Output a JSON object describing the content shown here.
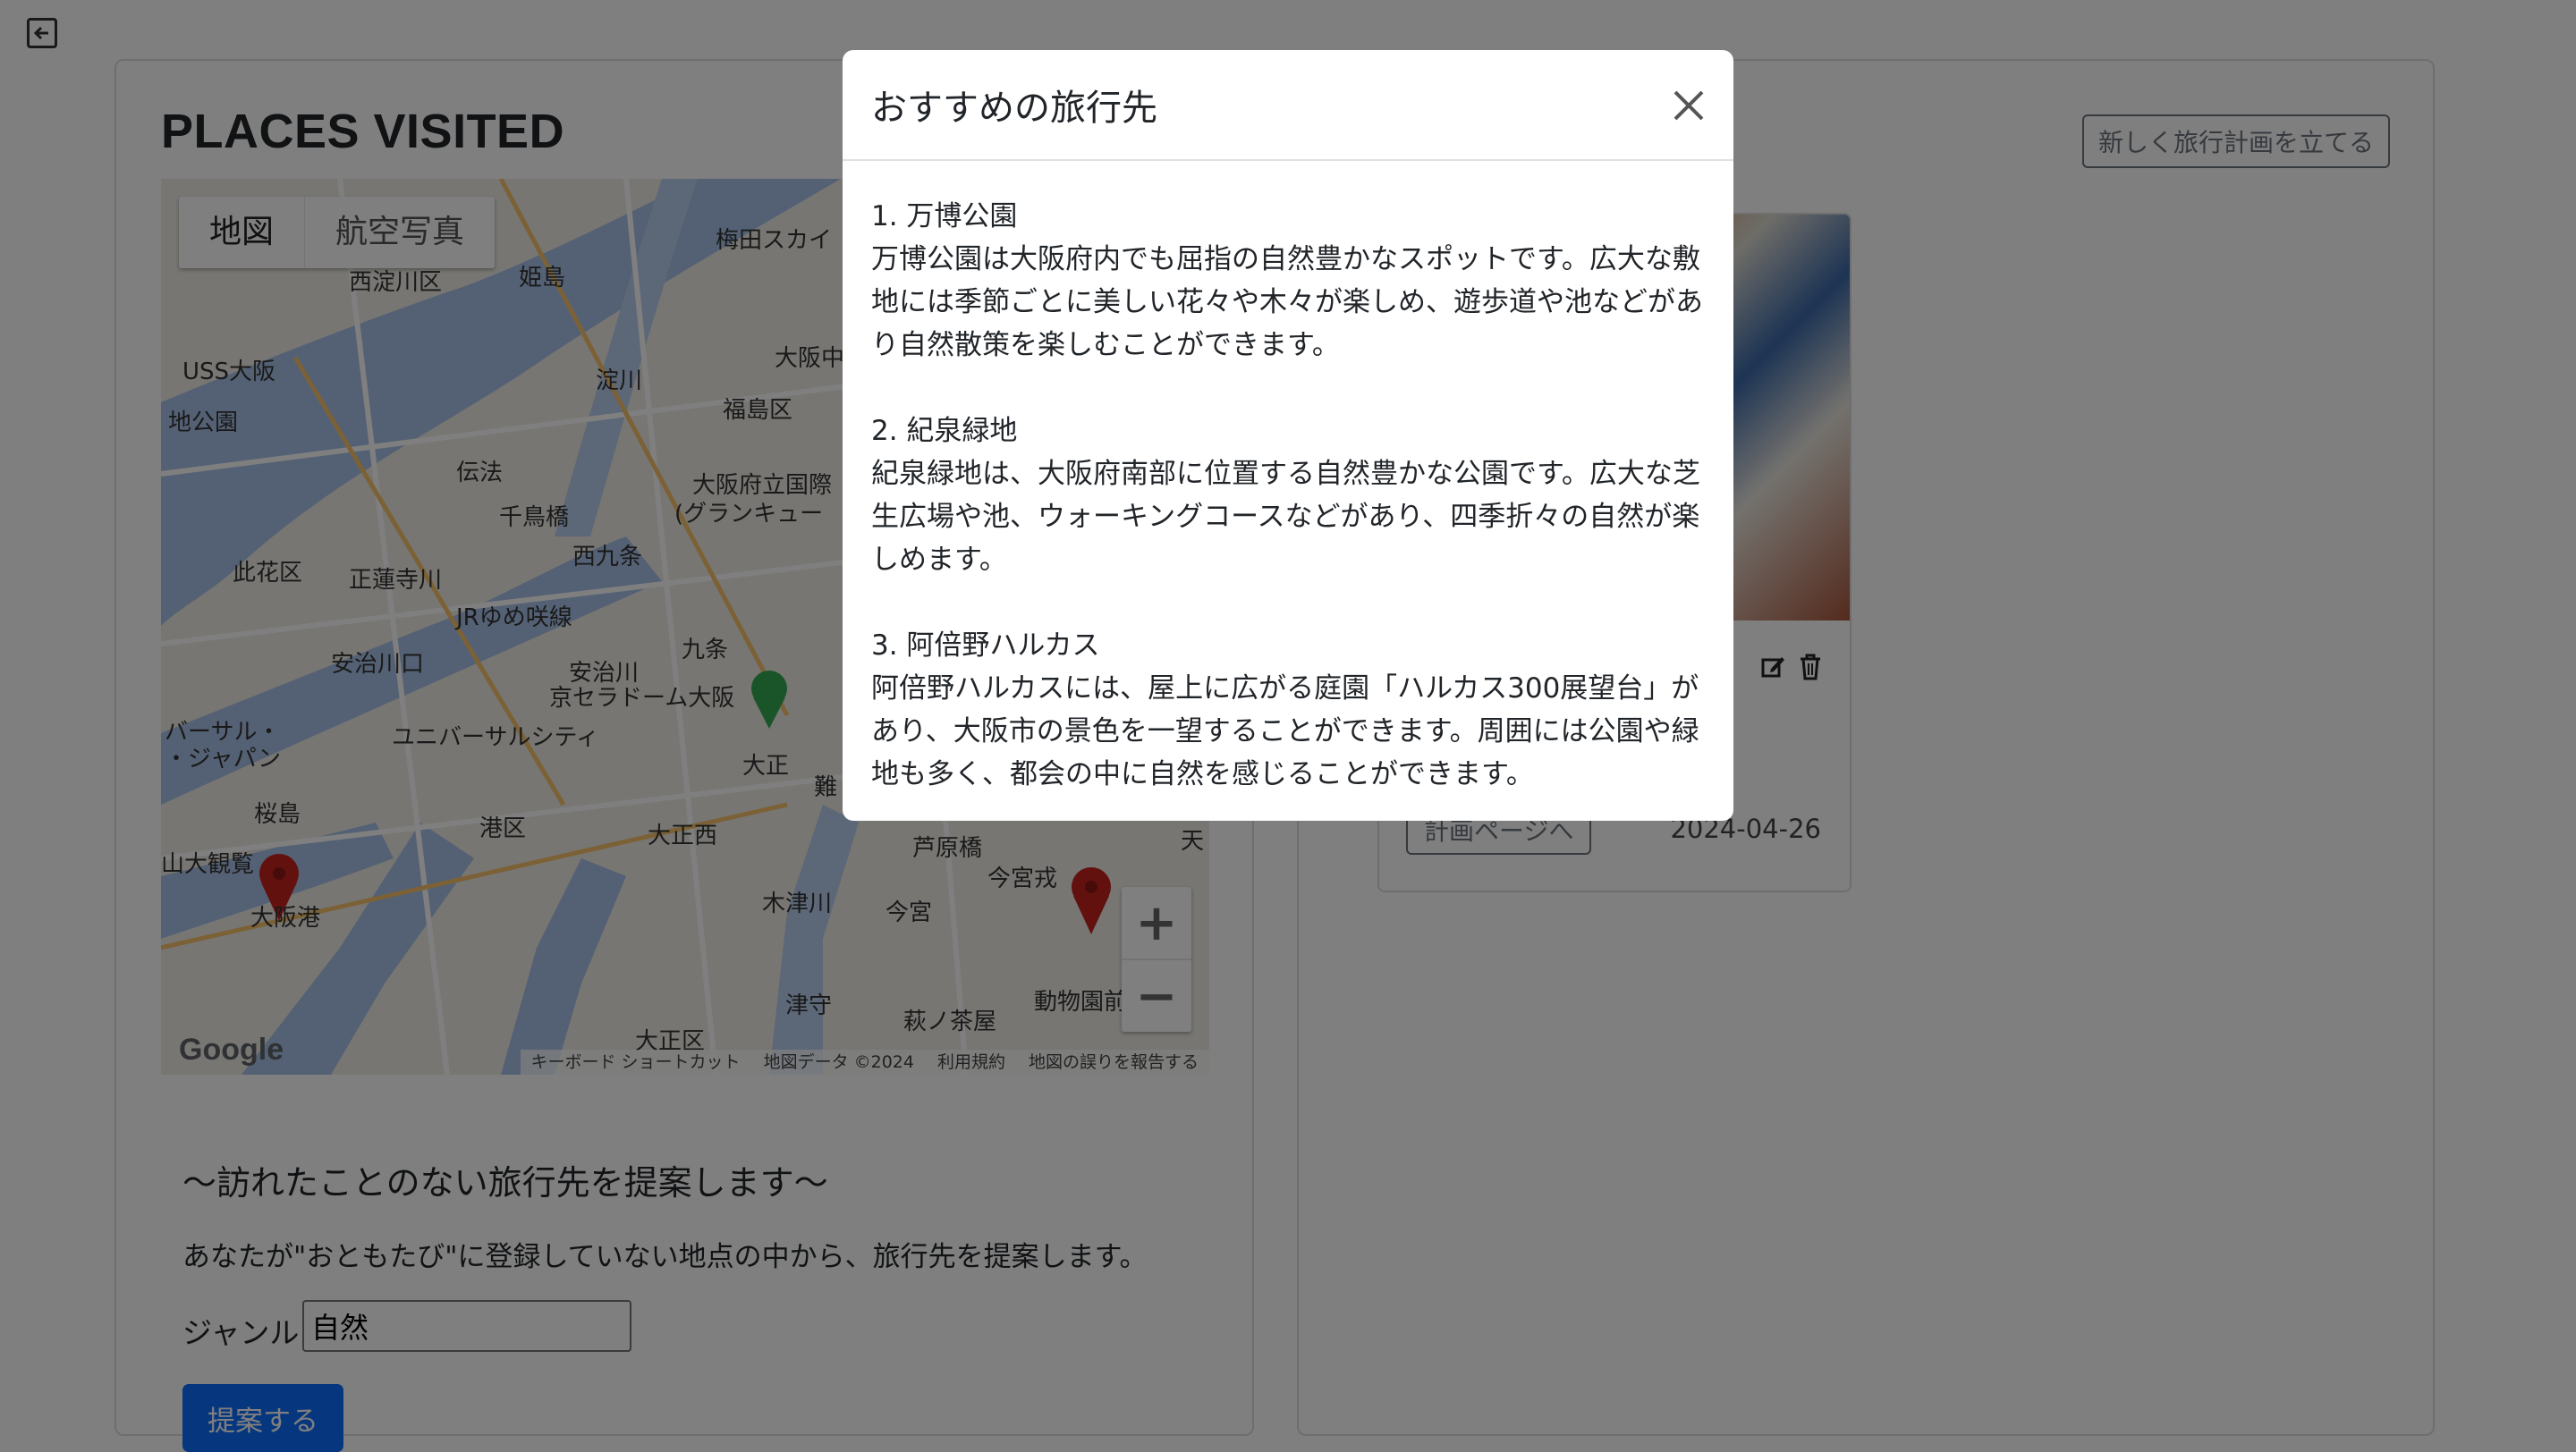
{
  "page": {
    "title": "PLACES VISITED",
    "new_plan_label": "新しく旅行計画を立てる"
  },
  "map": {
    "type_buttons": [
      "地図",
      "航空写真"
    ],
    "zoom_in": "+",
    "zoom_out": "−",
    "google_logo": "Google",
    "attribution": [
      "キーボード ショートカット",
      "地図データ ©2024",
      "利用規約",
      "地図の誤りを報告する"
    ],
    "labels": [
      "西淀川区",
      "姫島",
      "梅田スカイ",
      "USS大阪",
      "地公園",
      "淀川",
      "大阪中",
      "福島区",
      "伝法",
      "千鳥橋",
      "大阪府立国際",
      "(グランキュー",
      "西九条",
      "此花区",
      "正蓮寺川",
      "JRゆめ咲線",
      "安治川口",
      "九条",
      "京セラドーム大阪",
      "安治川",
      "ユニバーサルシティ",
      "バーサル・",
      "・ジャパン",
      "大正",
      "桜島",
      "港区",
      "大正西",
      "難",
      "芦原橋",
      "大阪港",
      "山大観覧",
      "木津川",
      "今宮",
      "今宮戎",
      "大正区",
      "津守",
      "萩ノ茶屋",
      "動物園前",
      "天"
    ]
  },
  "suggest": {
    "heading": "〜訪れたことのない旅行先を提案します〜",
    "description": "あなたが\"おともたび\"に登録していない地点の中から、旅行先を提案します。",
    "genre_label": "ジャンル",
    "genre_value": "自然",
    "button_label": "提案する"
  },
  "trip": {
    "plan_button": "計画ページへ",
    "date": "2024-04-26"
  },
  "modal": {
    "title": "おすすめの旅行先",
    "items": [
      {
        "name": "1. 万博公園",
        "text": "万博公園は大阪府内でも屈指の自然豊かなスポットです。広大な敷地には季節ごとに美しい花々や木々が楽しめ、遊歩道や池などがあり自然散策を楽しむことができます。"
      },
      {
        "name": "2. 紀泉緑地",
        "text": "紀泉緑地は、大阪府南部に位置する自然豊かな公園です。広大な芝生広場や池、ウォーキングコースなどがあり、四季折々の自然が楽しめます。"
      },
      {
        "name": "3. 阿倍野ハルカス",
        "text": "阿倍野ハルカスには、屋上に広がる庭園「ハルカス300展望台」があり、大阪市の景色を一望することができます。周囲には公園や緑地も多く、都会の中に自然を感じることができます。"
      }
    ]
  },
  "colors": {
    "primary": "#0d6efd",
    "secondary": "#6c757d",
    "water": "#a9c3e8",
    "backdrop": "rgba(0,0,0,0.5)"
  }
}
